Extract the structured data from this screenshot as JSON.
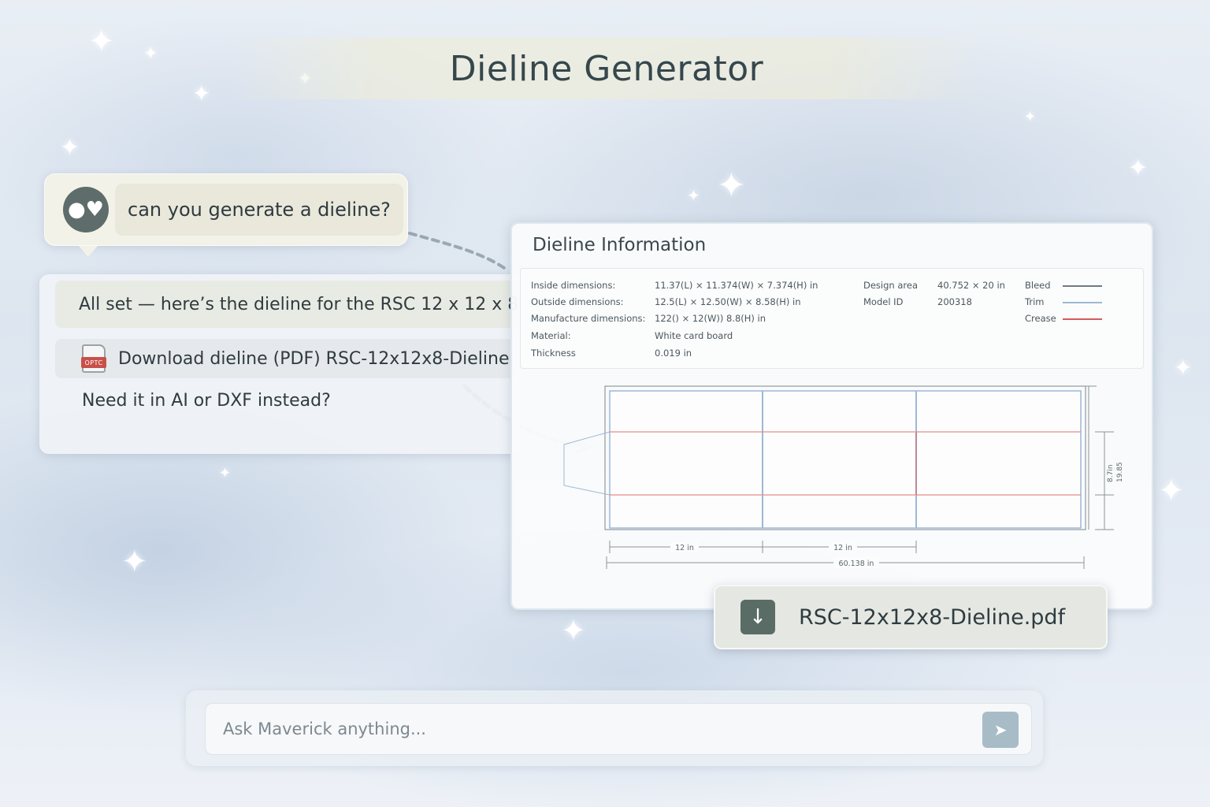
{
  "header": {
    "title": "Dieline Generator"
  },
  "chat": {
    "user_message": "can you generate a dieline?",
    "assistant": {
      "intro": "All set — here’s the dieline for the RSC 12 x 12 x 8.",
      "download_label": "Download dieline (PDF) RSC-12x12x8-Dieline",
      "pdf_tag": "OPTC",
      "followup": "Need it in AI or DXF instead?"
    }
  },
  "panel": {
    "title": "Dieline Information",
    "rows": [
      {
        "label": "Inside dimensions:",
        "value": "11.37(L) × 11.374(W) × 7.374(H) in"
      },
      {
        "label": "Outside dimensions:",
        "value": "12.5(L) × 12.50(W) × 8.58(H) in"
      },
      {
        "label": "Manufacture dimensions:",
        "value": "122() × 12(W)) 8.8(H) in"
      },
      {
        "label": "Material:",
        "value": "White card board"
      },
      {
        "label": "Thickness",
        "value": "0.019 in"
      }
    ],
    "meta": [
      {
        "label": "Design area",
        "value": "40.752 × 20 in"
      },
      {
        "label": "Model ID",
        "value": "200318"
      }
    ],
    "legend": [
      {
        "label": "Bleed",
        "color": "#6f7a80"
      },
      {
        "label": "Trim",
        "color": "#9db8d6"
      },
      {
        "label": "Crease",
        "color": "#d55b5b"
      }
    ],
    "drawing": {
      "panel_width_label_1": "12 in",
      "panel_width_label_2": "12 in",
      "total_width_label": "60.138 in",
      "height_label_1": "8.7in",
      "height_label_2": "19.85"
    }
  },
  "file_chip": {
    "filename": "RSC-12x12x8-Dieline.pdf"
  },
  "composer": {
    "placeholder": "Ask Maverick anything..."
  }
}
